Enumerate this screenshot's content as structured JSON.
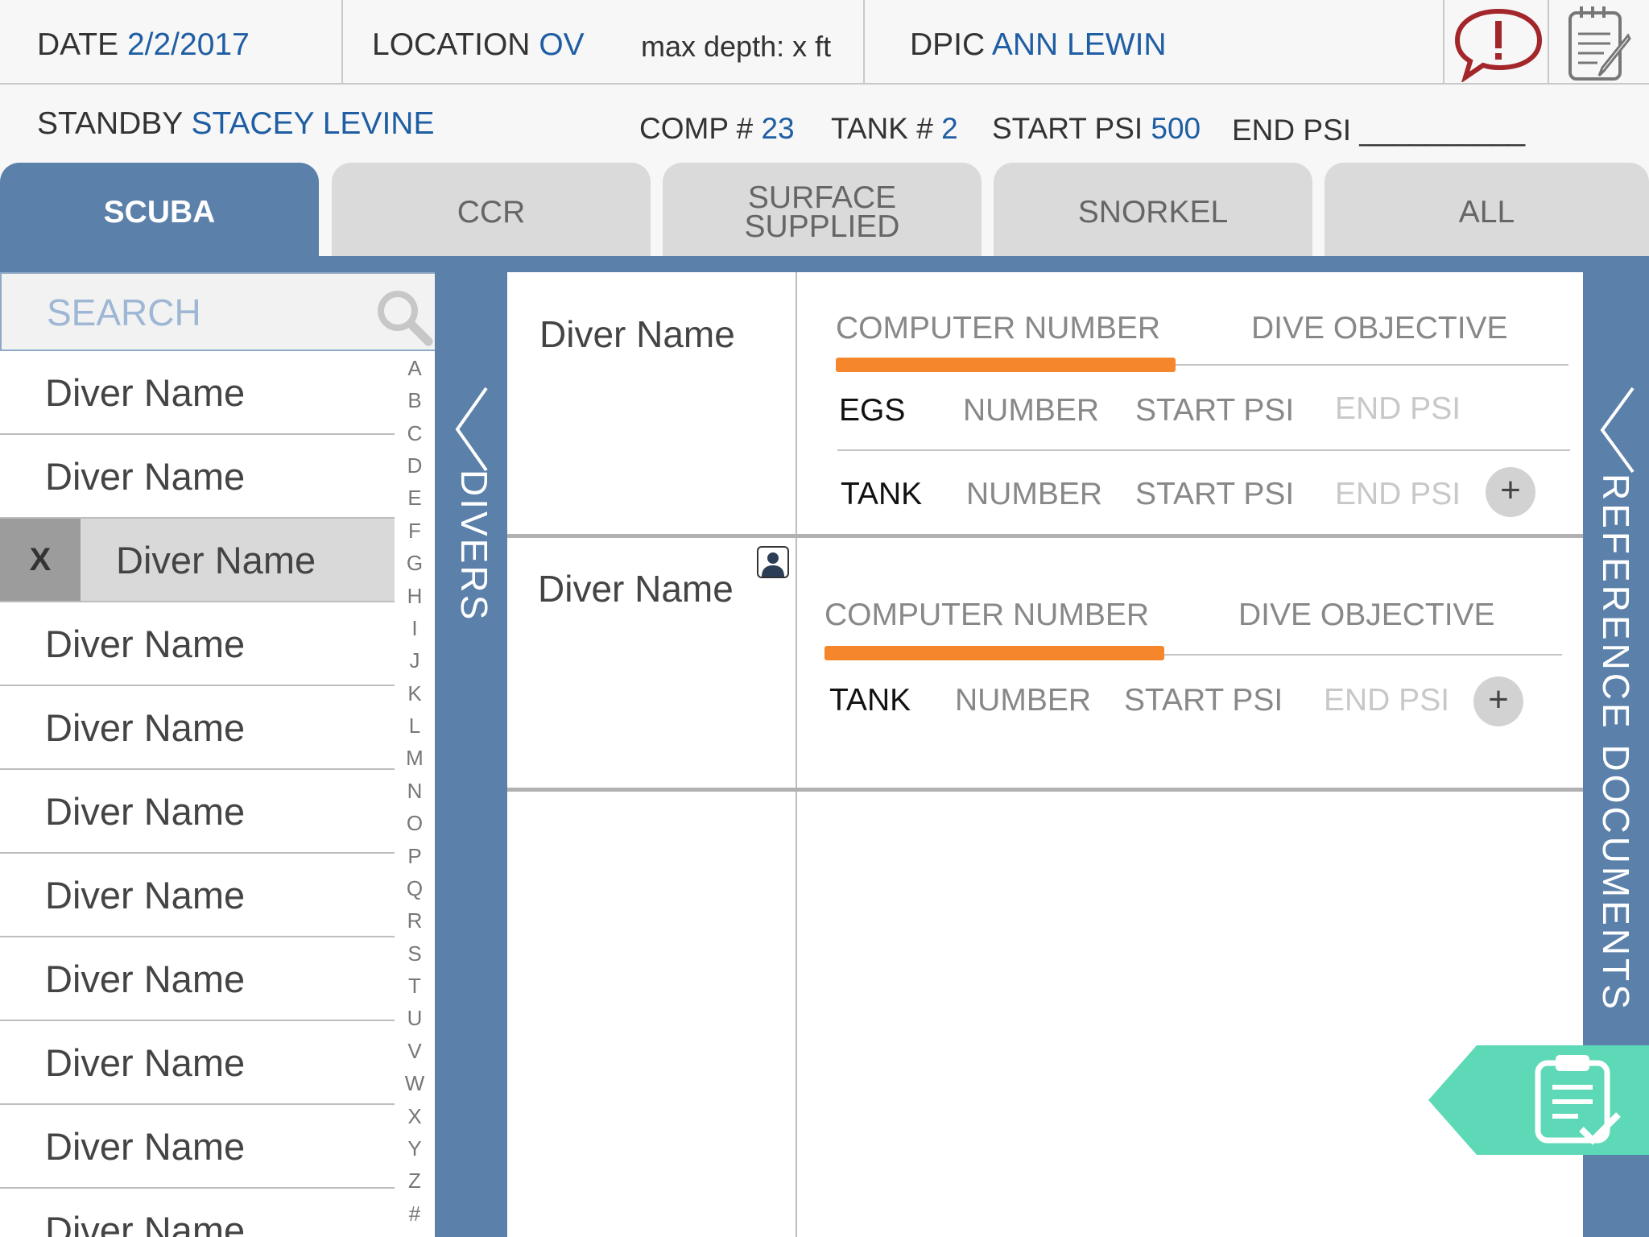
{
  "header": {
    "date_label": "DATE",
    "date_value": "2/2/2017",
    "location_label": "LOCATION",
    "location_value": "OV",
    "max_depth": "max depth: x ft",
    "dpic_label": "DPIC",
    "dpic_value": "ANN LEWIN",
    "alert_icon": "alert-speech-icon",
    "notes_icon": "notepad-icon"
  },
  "subheader": {
    "standby_label": "STANDBY",
    "standby_value": "STACEY LEVINE",
    "comp_label": "COMP #",
    "comp_value": "23",
    "tank_label": "TANK #",
    "tank_value": "2",
    "start_psi_label": "START PSI",
    "start_psi_value": "500",
    "end_psi_label": "END PSI",
    "end_psi_value": "__________"
  },
  "tabs": [
    {
      "label": "SCUBA",
      "active": true
    },
    {
      "label": "CCR",
      "active": false
    },
    {
      "label": "SURFACE SUPPLIED",
      "line1": "SURFACE",
      "line2": "SUPPLIED",
      "active": false
    },
    {
      "label": "SNORKEL",
      "active": false
    },
    {
      "label": "ALL",
      "active": false
    }
  ],
  "search": {
    "placeholder": "SEARCH",
    "add_label": "+"
  },
  "divers_panel_label": "DIVERS",
  "divers": [
    {
      "name": "Diver Name",
      "selected": false
    },
    {
      "name": "Diver Name",
      "selected": false
    },
    {
      "name": "Diver Name",
      "selected": true,
      "remove_label": "X"
    },
    {
      "name": "Diver Name",
      "selected": false
    },
    {
      "name": "Diver Name",
      "selected": false
    },
    {
      "name": "Diver Name",
      "selected": false
    },
    {
      "name": "Diver Name",
      "selected": false
    },
    {
      "name": "Diver Name",
      "selected": false
    },
    {
      "name": "Diver Name",
      "selected": false
    },
    {
      "name": "Diver Name",
      "selected": false
    },
    {
      "name": "Diver Name",
      "selected": false
    }
  ],
  "alphabet": [
    "A",
    "B",
    "C",
    "D",
    "E",
    "F",
    "G",
    "H",
    "I",
    "J",
    "K",
    "L",
    "M",
    "N",
    "O",
    "P",
    "Q",
    "R",
    "S",
    "T",
    "U",
    "V",
    "W",
    "X",
    "Y",
    "Z",
    "#"
  ],
  "cards": [
    {
      "diver_name": "Diver Name",
      "computer_number_label": "COMPUTER NUMBER",
      "dive_objective_label": "DIVE OBJECTIVE",
      "rows": [
        {
          "label": "EGS",
          "number": "NUMBER",
          "start_psi": "START PSI",
          "end_psi": "END PSI"
        },
        {
          "label": "TANK",
          "number": "NUMBER",
          "start_psi": "START PSI",
          "end_psi": "END PSI"
        }
      ],
      "add_label": "+"
    },
    {
      "diver_name": "Diver Name",
      "computer_number_label": "COMPUTER NUMBER",
      "dive_objective_label": "DIVE OBJECTIVE",
      "rows": [
        {
          "label": "TANK",
          "number": "NUMBER",
          "start_psi": "START PSI",
          "end_psi": "END PSI"
        }
      ],
      "add_label": "+"
    }
  ],
  "reference_panel_label": "REFERENCE DOCUMENTS",
  "colors": {
    "accent_blue": "#5b80aa",
    "value_blue": "#1f5ea3",
    "orange": "#f5862b",
    "teal": "#5ed9b8",
    "alert_red": "#a3262a"
  }
}
